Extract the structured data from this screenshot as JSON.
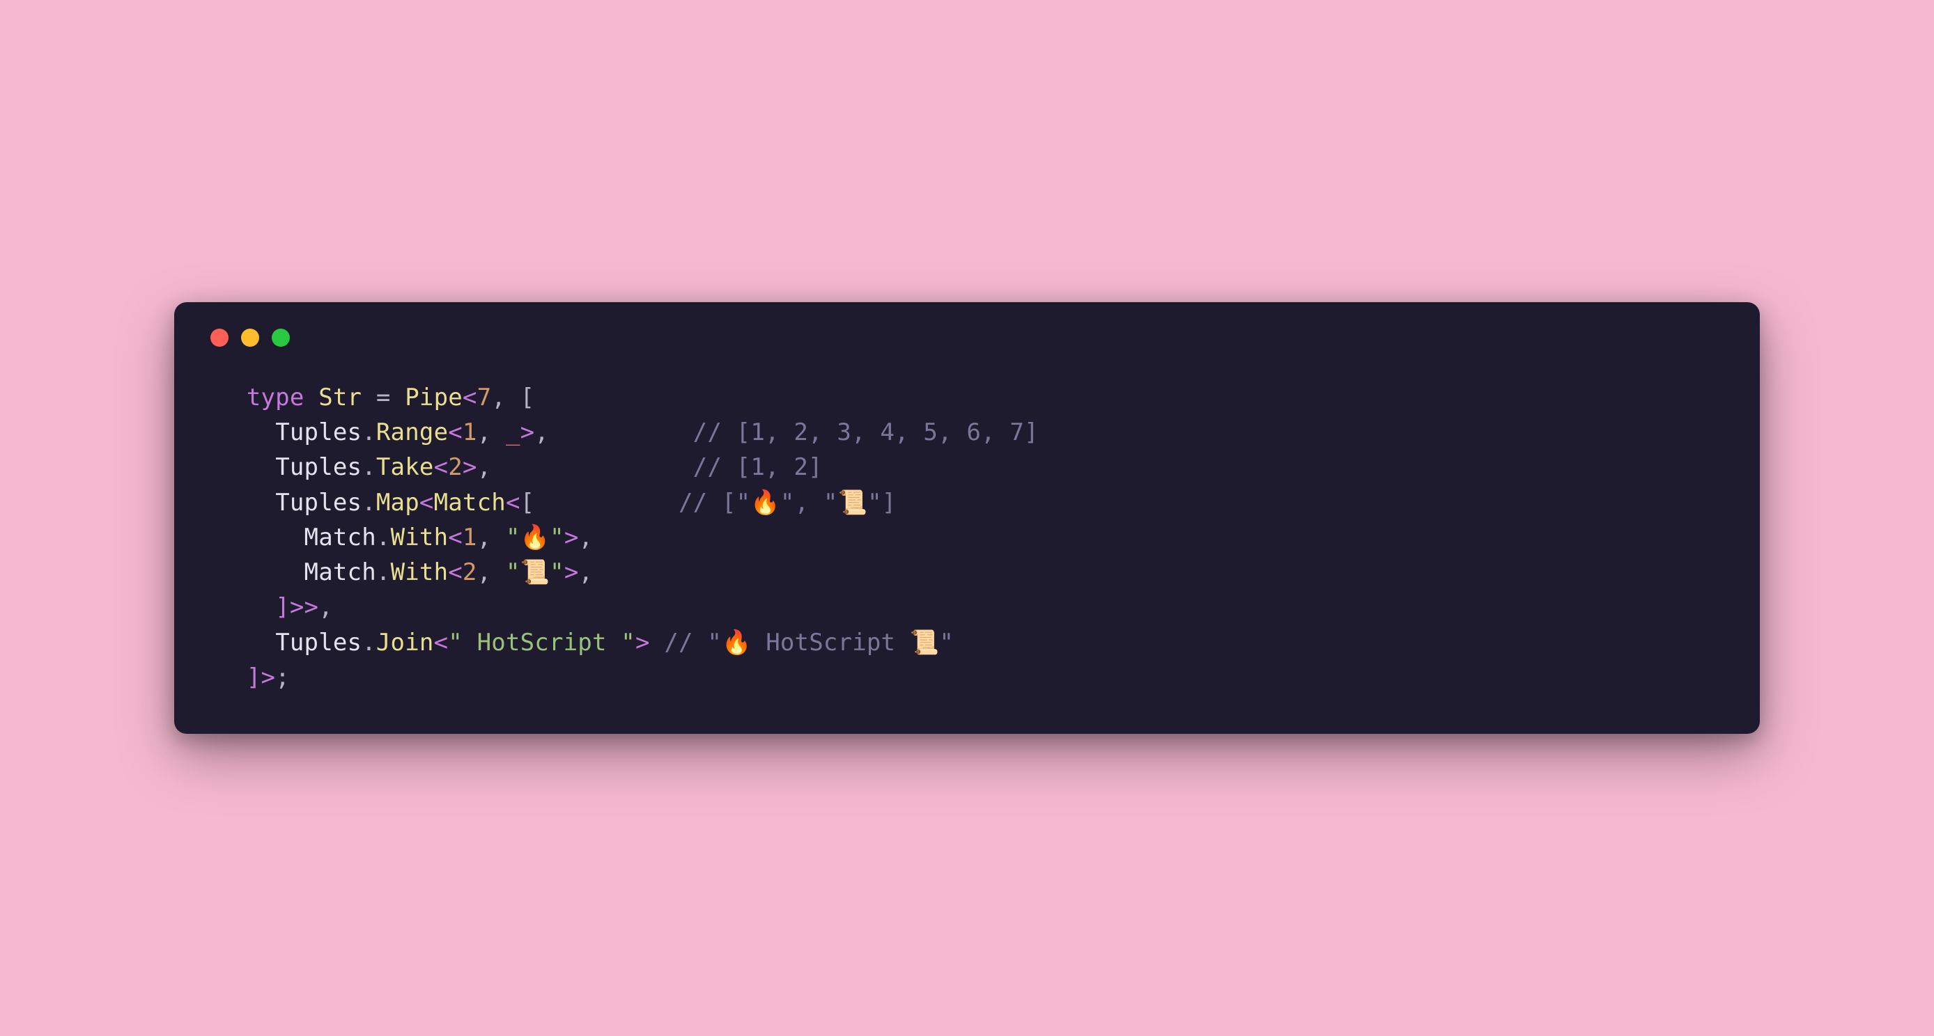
{
  "code": {
    "l1": {
      "kw": "type",
      "name": "Str",
      "eq": "=",
      "pipe": "Pipe",
      "a1": "<",
      "n7": "7",
      "c1": ",",
      "br": "["
    },
    "l2": {
      "indent": "  ",
      "tuples": "Tuples",
      "dot": ".",
      "range": "Range",
      "a1": "<",
      "n1": "1",
      "c1": ",",
      "sp": " ",
      "us": "_",
      "a2": ">",
      "c2": ",",
      "pad": "          ",
      "comment": "// [1, 2, 3, 4, 5, 6, 7]"
    },
    "l3": {
      "indent": "  ",
      "tuples": "Tuples",
      "dot": ".",
      "take": "Take",
      "a1": "<",
      "n2": "2",
      "a2": ">",
      "c1": ",",
      "pad": "              ",
      "comment": "// [1, 2]"
    },
    "l4": {
      "indent": "  ",
      "tuples": "Tuples",
      "dot": ".",
      "map": "Map",
      "a1": "<",
      "match": "Match",
      "a2": "<",
      "br": "[",
      "pad": "          ",
      "comment": "// [\"🔥\", \"📜\"]"
    },
    "l5": {
      "indent": "    ",
      "match": "Match",
      "dot": ".",
      "with": "With",
      "a1": "<",
      "n1": "1",
      "c1": ",",
      "sp": " ",
      "str": "\"🔥\"",
      "a2": ">",
      "c2": ","
    },
    "l6": {
      "indent": "    ",
      "match": "Match",
      "dot": ".",
      "with": "With",
      "a1": "<",
      "n2": "2",
      "c1": ",",
      "sp": " ",
      "str": "\"📜\"",
      "a2": ">",
      "c2": ","
    },
    "l7": {
      "indent": "  ",
      "close": "]>>",
      "c1": ","
    },
    "l8": {
      "indent": "  ",
      "tuples": "Tuples",
      "dot": ".",
      "join": "Join",
      "a1": "<",
      "str": "\" HotScript \"",
      "a2": ">",
      "sp": " ",
      "comment": "// \"🔥 HotScript 📜\""
    },
    "l9": {
      "close": "]>",
      "semi": ";"
    }
  }
}
